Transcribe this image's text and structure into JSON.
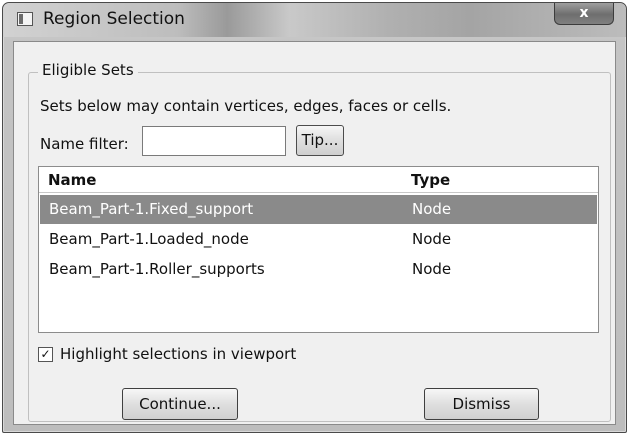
{
  "window": {
    "title": "Region Selection",
    "close_label": "x"
  },
  "group": {
    "label": "Eligible Sets",
    "description": "Sets below may contain vertices, edges, faces or cells."
  },
  "filter": {
    "label": "Name filter:",
    "value": "",
    "tip_label": "Tip..."
  },
  "list": {
    "columns": [
      "Name",
      "Type"
    ],
    "rows": [
      {
        "name": "Beam_Part-1.Fixed_support",
        "type": "Node",
        "selected": true
      },
      {
        "name": "Beam_Part-1.Loaded_node",
        "type": "Node",
        "selected": false
      },
      {
        "name": "Beam_Part-1.Roller_supports",
        "type": "Node",
        "selected": false
      }
    ]
  },
  "highlight": {
    "label": "Highlight selections in viewport",
    "checked": true,
    "check_glyph": "✓"
  },
  "buttons": {
    "continue_label": "Continue...",
    "dismiss_label": "Dismiss"
  },
  "colors": {
    "selected_row_bg": "#8a8a8a"
  }
}
